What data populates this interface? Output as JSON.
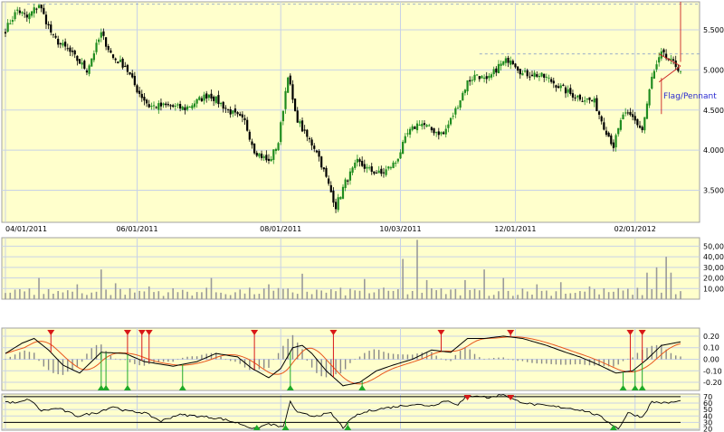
{
  "colors": {
    "background": "#ffffcc",
    "panel_border": "#a0a0a0",
    "grid": "#c8d2e6",
    "candle_up": "#1f8c1f",
    "candle_down": "#000000",
    "volume_bar": "#9a9a9a",
    "macd_line": "#000000",
    "signal_line": "#e8571e",
    "histogram": "#8a8a8a",
    "marker_sell": "#d81818",
    "marker_buy": "#1faa2a",
    "annotation": "#2a2ad0",
    "pattern_line": "#cc2222",
    "resistance_line": "#8aa0c8",
    "rsi_band": "#000000"
  },
  "chart_data": [
    {
      "type": "candlestick",
      "panel": "price",
      "x_tick_labels": [
        "04/01/2011",
        "06/01/2011",
        "08/01/2011",
        "10/03/2011",
        "12/01/2011",
        "02/01/2012"
      ],
      "y_tick_labels": [
        "3.5000",
        "4.0000",
        "4.5000",
        "5.0000",
        "5.5000"
      ],
      "ylim": [
        3.1,
        5.85
      ],
      "grid": true,
      "annotation": "Flag/Pennant",
      "resistance_levels": [
        5.82,
        5.2
      ],
      "anchors": [
        [
          0,
          5.5
        ],
        [
          5,
          5.75
        ],
        [
          9,
          5.65
        ],
        [
          14,
          5.82
        ],
        [
          20,
          5.4
        ],
        [
          26,
          5.25
        ],
        [
          34,
          5.0
        ],
        [
          40,
          5.45
        ],
        [
          45,
          5.15
        ],
        [
          50,
          5.05
        ],
        [
          55,
          4.75
        ],
        [
          60,
          4.55
        ],
        [
          68,
          4.55
        ],
        [
          75,
          4.52
        ],
        [
          85,
          4.7
        ],
        [
          93,
          4.5
        ],
        [
          100,
          4.35
        ],
        [
          104,
          4.0
        ],
        [
          110,
          3.85
        ],
        [
          114,
          4.1
        ],
        [
          118,
          4.95
        ],
        [
          121,
          4.45
        ],
        [
          125,
          4.2
        ],
        [
          130,
          4.0
        ],
        [
          134,
          3.65
        ],
        [
          138,
          3.3
        ],
        [
          142,
          3.6
        ],
        [
          147,
          3.85
        ],
        [
          152,
          3.75
        ],
        [
          157,
          3.7
        ],
        [
          163,
          3.85
        ],
        [
          168,
          4.2
        ],
        [
          173,
          4.35
        ],
        [
          178,
          4.25
        ],
        [
          183,
          4.2
        ],
        [
          188,
          4.5
        ],
        [
          193,
          4.85
        ],
        [
          197,
          4.95
        ],
        [
          201,
          4.85
        ],
        [
          206,
          5.05
        ],
        [
          211,
          5.15
        ],
        [
          216,
          4.95
        ],
        [
          221,
          4.95
        ],
        [
          226,
          4.9
        ],
        [
          231,
          4.8
        ],
        [
          236,
          4.7
        ],
        [
          241,
          4.65
        ],
        [
          246,
          4.6
        ],
        [
          250,
          4.3
        ],
        [
          254,
          4.05
        ],
        [
          258,
          4.45
        ],
        [
          262,
          4.4
        ],
        [
          266,
          4.25
        ],
        [
          270,
          4.9
        ],
        [
          274,
          5.2
        ],
        [
          278,
          5.1
        ],
        [
          282,
          5.0
        ]
      ],
      "volume": {
        "y_tick_labels": [
          "10,000",
          "20,000",
          "30,000",
          "40,000",
          "50,000"
        ],
        "ylim": [
          0,
          58000
        ],
        "spikes": [
          [
            5,
            9000
          ],
          [
            15,
            20000
          ],
          [
            30,
            14000
          ],
          [
            41,
            28000
          ],
          [
            47,
            15000
          ],
          [
            60,
            12000
          ],
          [
            86,
            20000
          ],
          [
            110,
            14000
          ],
          [
            125,
            24000
          ],
          [
            150,
            19000
          ],
          [
            167,
            38000
          ],
          [
            172,
            56000
          ],
          [
            173,
            42000
          ],
          [
            176,
            18000
          ],
          [
            193,
            18000
          ],
          [
            200,
            28000
          ],
          [
            208,
            20000
          ],
          [
            222,
            14000
          ],
          [
            232,
            16000
          ],
          [
            245,
            12000
          ],
          [
            268,
            25000
          ],
          [
            273,
            30000
          ],
          [
            276,
            40000
          ],
          [
            278,
            25000
          ]
        ]
      }
    },
    {
      "type": "line",
      "panel": "macd",
      "y_tick_labels": [
        "0.20",
        "0.10",
        "0.00",
        "-0.10",
        "-0.20"
      ],
      "ylim": [
        -0.27,
        0.27
      ],
      "series": [],
      "anchors": [
        [
          0,
          0.05
        ],
        [
          7,
          0.14
        ],
        [
          12,
          0.18
        ],
        [
          18,
          0.08
        ],
        [
          24,
          -0.05
        ],
        [
          31,
          -0.12
        ],
        [
          40,
          0.06
        ],
        [
          50,
          0.05
        ],
        [
          58,
          -0.02
        ],
        [
          70,
          -0.06
        ],
        [
          80,
          -0.02
        ],
        [
          88,
          0.05
        ],
        [
          97,
          0.02
        ],
        [
          103,
          -0.08
        ],
        [
          110,
          -0.16
        ],
        [
          115,
          -0.08
        ],
        [
          120,
          0.1
        ],
        [
          124,
          0.12
        ],
        [
          128,
          0.05
        ],
        [
          134,
          -0.1
        ],
        [
          141,
          -0.23
        ],
        [
          148,
          -0.2
        ],
        [
          155,
          -0.1
        ],
        [
          162,
          -0.05
        ],
        [
          170,
          0.0
        ],
        [
          178,
          0.08
        ],
        [
          186,
          0.06
        ],
        [
          193,
          0.18
        ],
        [
          200,
          0.18
        ],
        [
          208,
          0.2
        ],
        [
          216,
          0.18
        ],
        [
          226,
          0.12
        ],
        [
          234,
          0.06
        ],
        [
          240,
          0.02
        ],
        [
          248,
          -0.05
        ],
        [
          255,
          -0.12
        ],
        [
          262,
          -0.1
        ],
        [
          268,
          0.0
        ],
        [
          274,
          0.12
        ],
        [
          282,
          0.15
        ]
      ],
      "sell_markers": [
        19,
        51,
        57,
        60,
        104,
        137,
        182,
        211,
        261,
        266
      ],
      "buy_markers": [
        40,
        42,
        51,
        74,
        119,
        149,
        258,
        263,
        266
      ]
    },
    {
      "type": "line",
      "panel": "rsi",
      "y_tick_labels": [
        "70",
        "60",
        "50",
        "40",
        "30",
        "20"
      ],
      "ylim": [
        18,
        74
      ],
      "band_levels": [
        70,
        30
      ],
      "anchors": [
        [
          0,
          62
        ],
        [
          5,
          60
        ],
        [
          10,
          66
        ],
        [
          15,
          48
        ],
        [
          22,
          52
        ],
        [
          30,
          40
        ],
        [
          38,
          45
        ],
        [
          45,
          55
        ],
        [
          50,
          48
        ],
        [
          58,
          45
        ],
        [
          65,
          32
        ],
        [
          72,
          42
        ],
        [
          80,
          40
        ],
        [
          90,
          36
        ],
        [
          98,
          28
        ],
        [
          104,
          20
        ],
        [
          110,
          28
        ],
        [
          116,
          22
        ],
        [
          119,
          62
        ],
        [
          122,
          45
        ],
        [
          128,
          40
        ],
        [
          136,
          44
        ],
        [
          141,
          22
        ],
        [
          146,
          40
        ],
        [
          152,
          48
        ],
        [
          158,
          52
        ],
        [
          164,
          55
        ],
        [
          170,
          58
        ],
        [
          178,
          56
        ],
        [
          184,
          64
        ],
        [
          189,
          58
        ],
        [
          193,
          70
        ],
        [
          197,
          72
        ],
        [
          202,
          68
        ],
        [
          208,
          74
        ],
        [
          213,
          64
        ],
        [
          220,
          58
        ],
        [
          228,
          55
        ],
        [
          236,
          52
        ],
        [
          242,
          48
        ],
        [
          248,
          40
        ],
        [
          253,
          28
        ],
        [
          256,
          20
        ],
        [
          260,
          45
        ],
        [
          266,
          38
        ],
        [
          270,
          62
        ],
        [
          276,
          60
        ],
        [
          282,
          63
        ]
      ],
      "sell_markers": [
        193,
        211
      ],
      "buy_markers": [
        105,
        117,
        143,
        254
      ]
    }
  ]
}
